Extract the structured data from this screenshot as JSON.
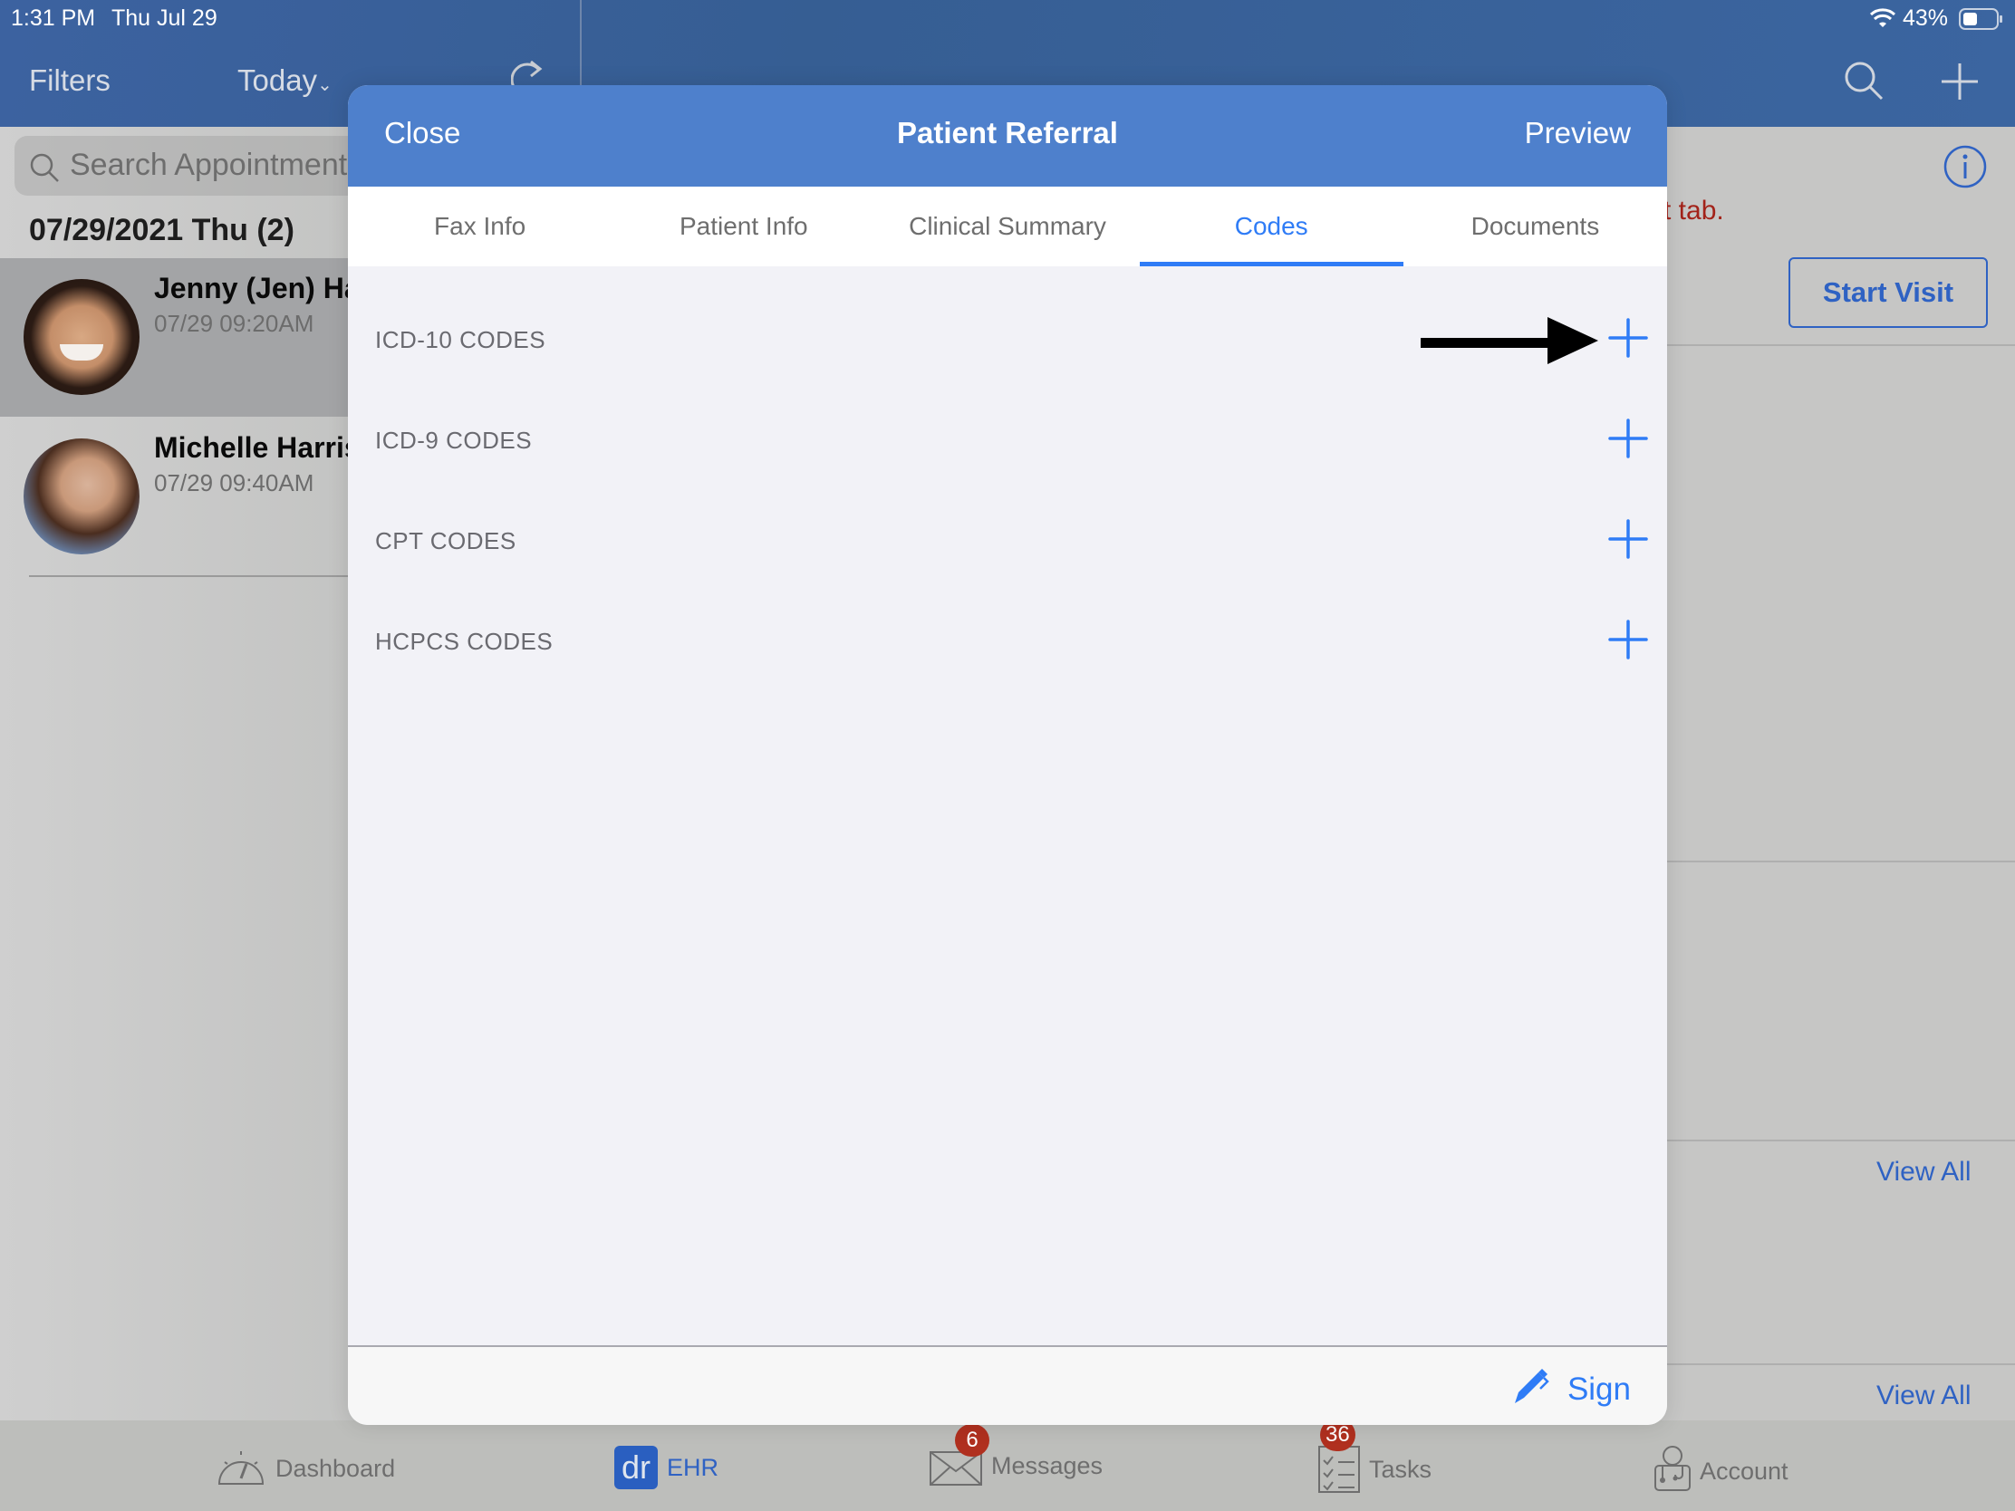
{
  "status_bar": {
    "time": "1:31 PM",
    "date": "Thu Jul 29",
    "battery": "43%",
    "icons": [
      "wifi-icon",
      "battery-icon"
    ]
  },
  "nav": {
    "filters_label": "Filters",
    "date_filter_label": "Today",
    "date_filter_icon": "chevron-down-icon",
    "refresh_icon": "refresh-icon",
    "search_icon": "search-icon",
    "add_icon": "plus-icon"
  },
  "appointments": {
    "search_placeholder": "Search Appointments",
    "date_header": "07/29/2021 Thu (2)",
    "items": [
      {
        "name": "Jenny (Jen) Ha",
        "time": "07/29 09:20AM",
        "selected": true
      },
      {
        "name": "Michelle Harris",
        "time": "07/29 09:40AM",
        "selected": false
      }
    ]
  },
  "detail": {
    "partial_notice": "t tab.",
    "start_visit_label": "Start Visit",
    "info_icon": "info-icon",
    "view_all_labels": [
      "View All",
      "View All"
    ]
  },
  "modal": {
    "close_label": "Close",
    "title": "Patient Referral",
    "preview_label": "Preview",
    "tabs": [
      {
        "label": "Fax Info",
        "active": false
      },
      {
        "label": "Patient Info",
        "active": false
      },
      {
        "label": "Clinical Summary",
        "active": false
      },
      {
        "label": "Codes",
        "active": true
      },
      {
        "label": "Documents",
        "active": false
      }
    ],
    "code_sections": [
      {
        "label": "ICD-10 CODES",
        "highlighted_by_arrow": true
      },
      {
        "label": "ICD-9 CODES",
        "highlighted_by_arrow": false
      },
      {
        "label": "CPT CODES",
        "highlighted_by_arrow": false
      },
      {
        "label": "HCPCS CODES",
        "highlighted_by_arrow": false
      }
    ],
    "sign_label": "Sign",
    "accent_color": "#2f7cf6",
    "header_color": "#4e80cc"
  },
  "tab_bar": {
    "items": [
      {
        "label": "Dashboard",
        "icon": "dashboard-gauge-icon",
        "badge": null,
        "active": false
      },
      {
        "label": "EHR",
        "icon": "dr-logo-icon",
        "badge": null,
        "active": true
      },
      {
        "label": "Messages",
        "icon": "envelope-icon",
        "badge": "6",
        "active": false
      },
      {
        "label": "Tasks",
        "icon": "checklist-icon",
        "badge": "36",
        "active": false
      },
      {
        "label": "Account",
        "icon": "doctor-account-icon",
        "badge": null,
        "active": false
      }
    ],
    "logo_text": "dr",
    "badge_color": "#b0301f"
  }
}
